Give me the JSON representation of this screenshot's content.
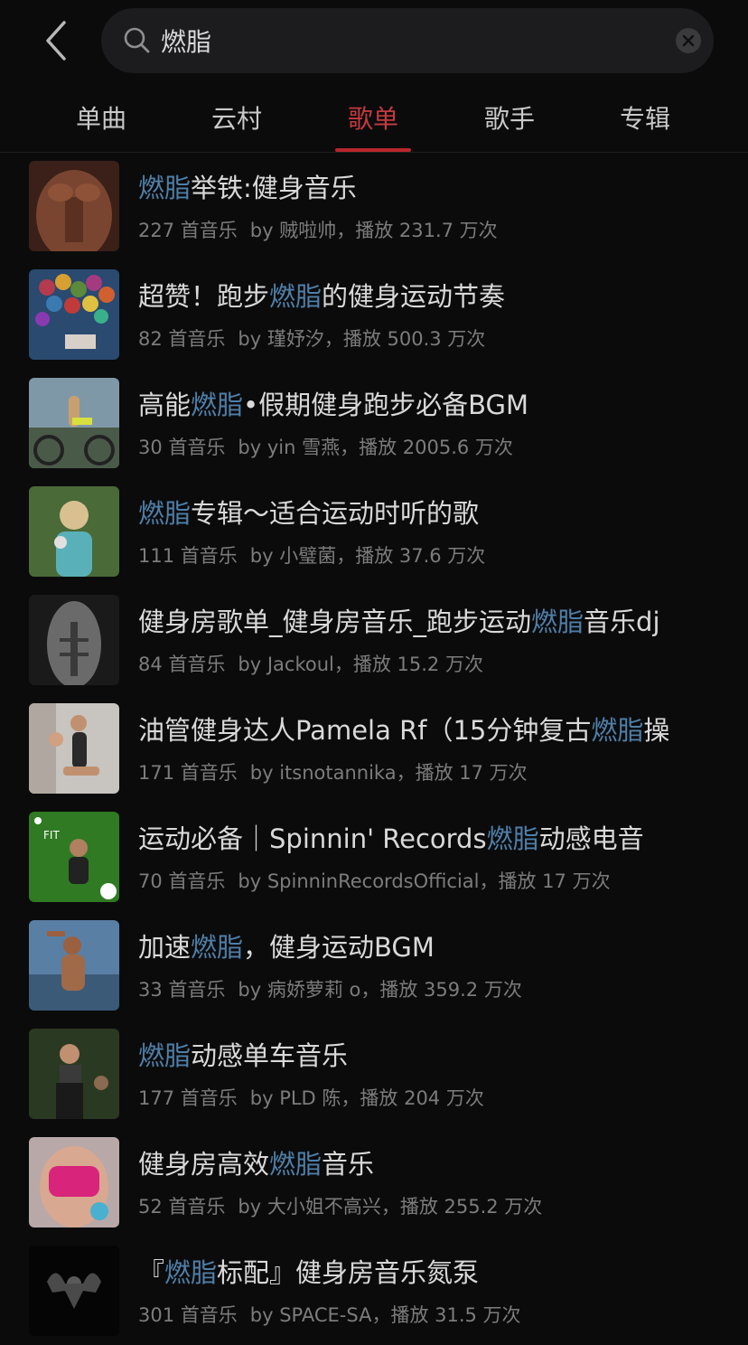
{
  "search": {
    "query": "燃脂"
  },
  "tabs": [
    {
      "label": "单曲",
      "active": false
    },
    {
      "label": "云村",
      "active": false
    },
    {
      "label": "歌单",
      "active": true
    },
    {
      "label": "歌手",
      "active": false
    },
    {
      "label": "专辑",
      "active": false
    }
  ],
  "colors": {
    "accent": "#c23a3f",
    "highlight": "#4f7fa8",
    "background": "#0b0b0c"
  },
  "playlists": [
    {
      "pre": "",
      "hl": "燃脂",
      "post": "举铁:健身音乐",
      "count": "227 首音乐",
      "by": "by 贼啦帅，播放 231.7 万次",
      "cover": "muscle-torso"
    },
    {
      "pre": "超赞！跑步",
      "hl": "燃脂",
      "post": "的健身运动节奏",
      "count": "82 首音乐",
      "by": "by 瑾妤汐，播放 500.3 万次",
      "cover": "balloons"
    },
    {
      "pre": "高能",
      "hl": "燃脂",
      "post": "•假期健身跑步必备BGM",
      "count": "30 首音乐",
      "by": "by yin 雪燕，播放 2005.6 万次",
      "cover": "cyclist"
    },
    {
      "pre": "",
      "hl": "燃脂",
      "post": "专辑～适合运动时听的歌",
      "count": "111 首音乐",
      "by": "by 小璧菌，播放 37.6 万次",
      "cover": "woman-outdoors"
    },
    {
      "pre": "健身房歌单_健身房音乐_跑步运动",
      "hl": "燃脂",
      "post": "音乐dj",
      "count": "84 首音乐",
      "by": "by Jackoul，播放 15.2 万次",
      "cover": "abs-bw"
    },
    {
      "pre": "油管健身达人Pamela Rf（15分钟复古",
      "hl": "燃脂",
      "post": "操",
      "count": "171 首音乐",
      "by": "by itsnotannika，播放 17 万次",
      "cover": "dancers"
    },
    {
      "pre": "运动必备｜Spinnin' Records",
      "hl": "燃脂",
      "post": "动感电音",
      "count": "70 首音乐",
      "by": "by SpinninRecordsOfficial，播放 17 万次",
      "cover": "fit-green"
    },
    {
      "pre": "加速",
      "hl": "燃脂",
      "post": "，健身运动BGM",
      "count": "33 首音乐",
      "by": "by 病娇萝莉 o，播放 359.2 万次",
      "cover": "man-sea"
    },
    {
      "pre": "",
      "hl": "燃脂",
      "post": "动感单车音乐",
      "count": "177 首音乐",
      "by": "by PLD 陈，播放 204 万次",
      "cover": "woman-forest"
    },
    {
      "pre": "健身房高效",
      "hl": "燃脂",
      "post": "音乐",
      "count": "52 首音乐",
      "by": "by 大小姐不高兴，播放 255.2 万次",
      "cover": "pink-top"
    },
    {
      "pre": "『",
      "hl": "燃脂",
      "post": "标配』健身房音乐氮泵",
      "count": "301 首音乐",
      "by": "by SPACE-SA，播放 31.5 万次",
      "cover": "dark-bodybuilder"
    }
  ]
}
